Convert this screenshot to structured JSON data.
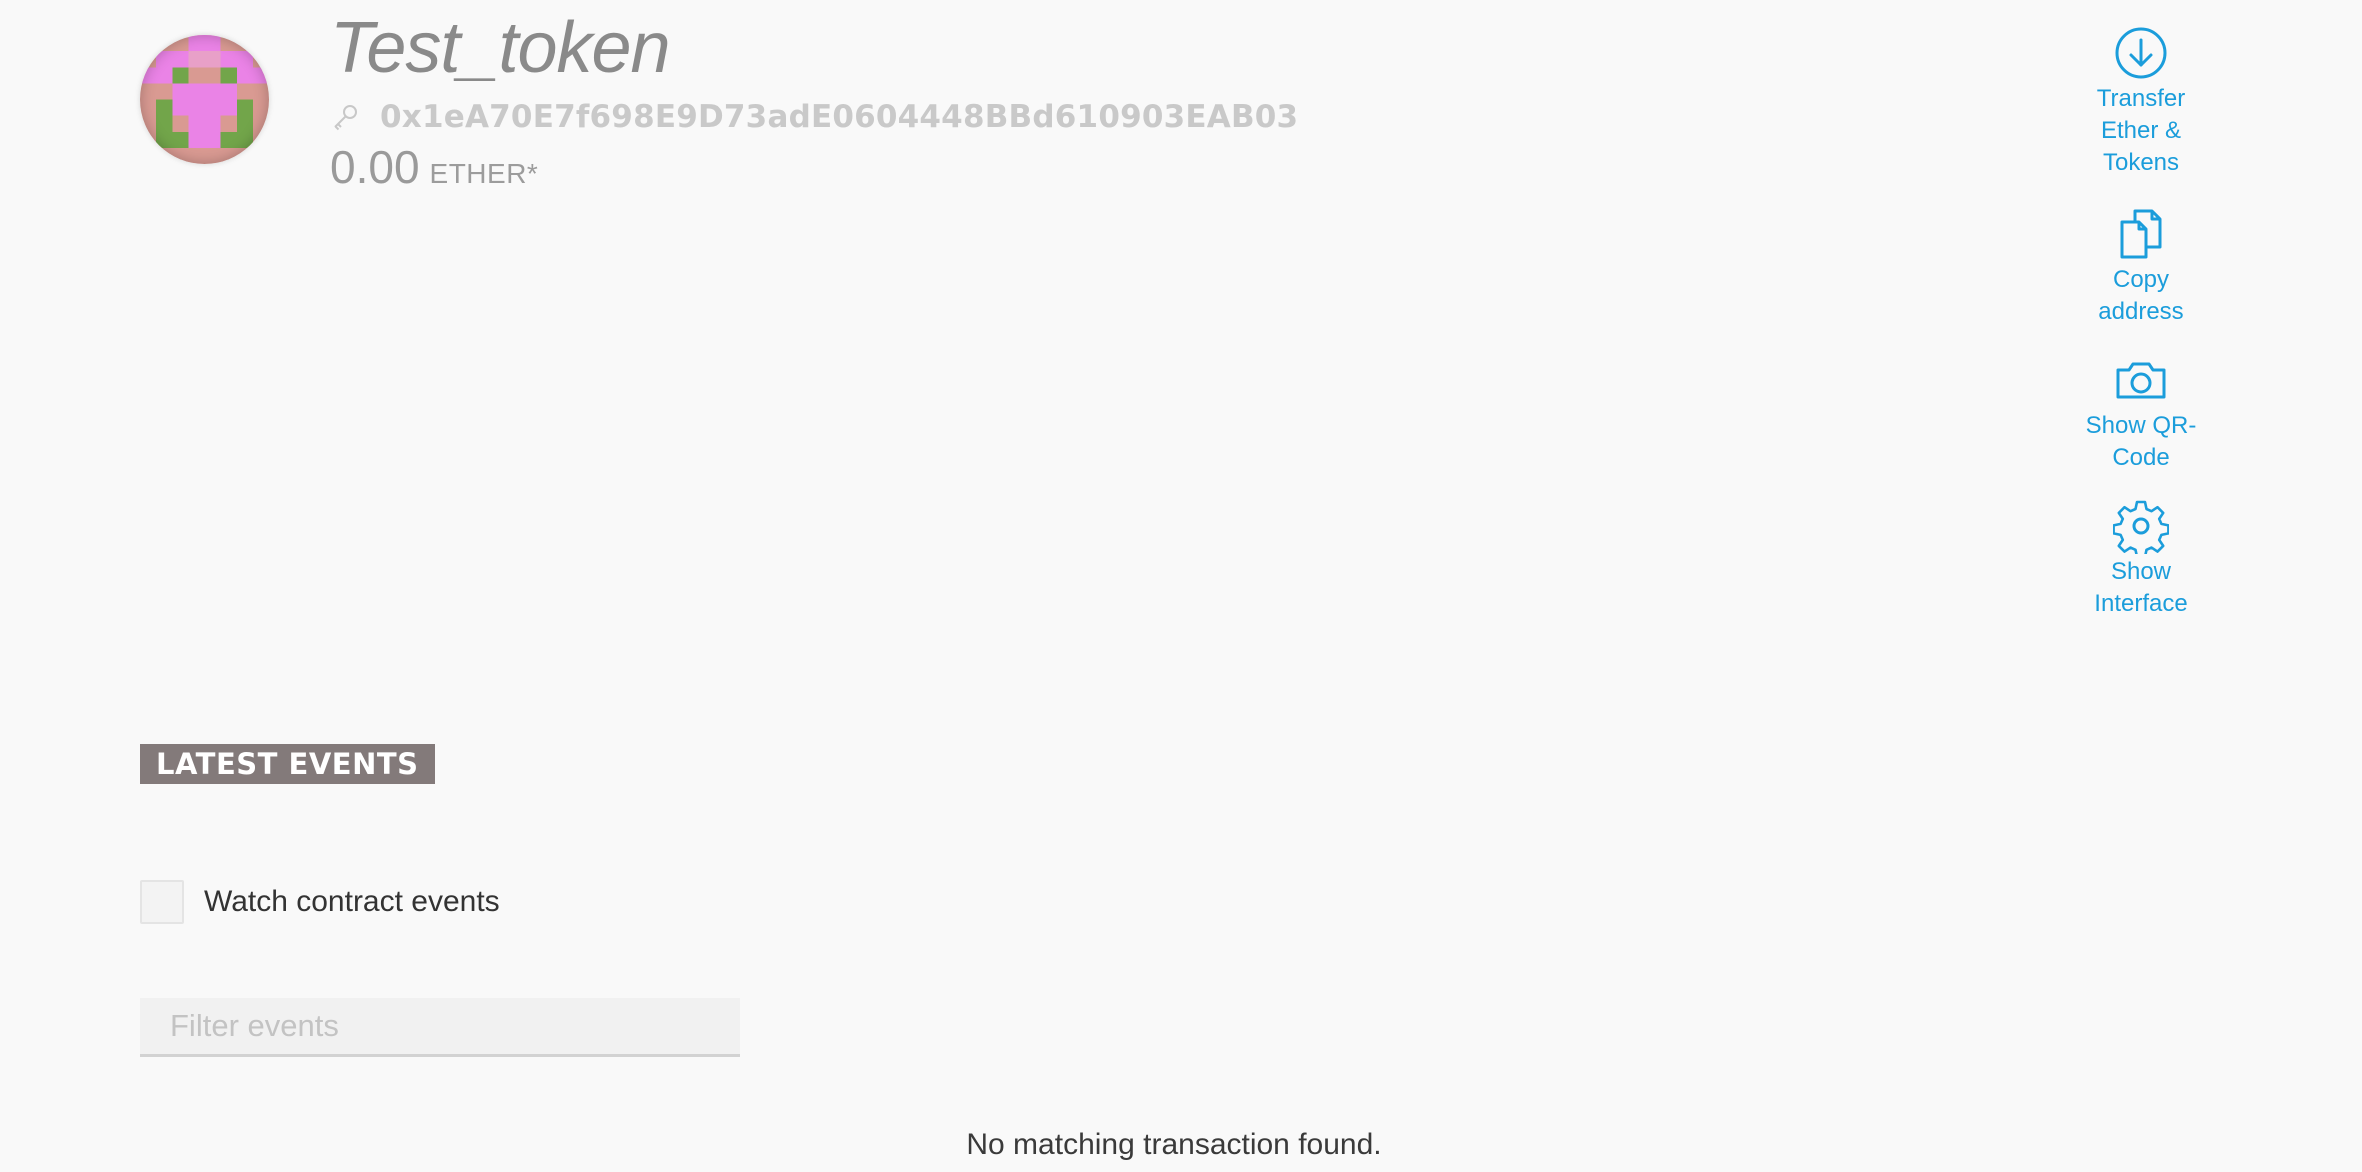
{
  "contract": {
    "name": "Test_token",
    "address": "0x1eA70E7f698E9D73adE0604448BBd610903EAB03",
    "balance": "0.00",
    "unit": "ETHER*"
  },
  "actions": [
    {
      "label_line1": "Transfer",
      "label_line2": "Ether &",
      "label_line3": "Tokens",
      "icon": "arrow-down-circle-icon"
    },
    {
      "label_line1": "Copy",
      "label_line2": "address",
      "icon": "copy-document-icon"
    },
    {
      "label_line1": "Show QR-",
      "label_line2": "Code",
      "icon": "camera-icon"
    },
    {
      "label_line1": "Show",
      "label_line2": "Interface",
      "icon": "gear-icon"
    }
  ],
  "events": {
    "heading": "LATEST EVENTS",
    "watch_label": "Watch contract events",
    "watch_checked": false,
    "filter_placeholder": "Filter events",
    "filter_value": "",
    "empty_message": "No matching transaction found."
  },
  "colors": {
    "accent": "#1b9ddb",
    "heading_bg": "#837a7a",
    "background": "#f9f9f9",
    "identicon_pink": "#ea83e6",
    "identicon_rose": "#d99a92",
    "identicon_green": "#72a54a"
  }
}
